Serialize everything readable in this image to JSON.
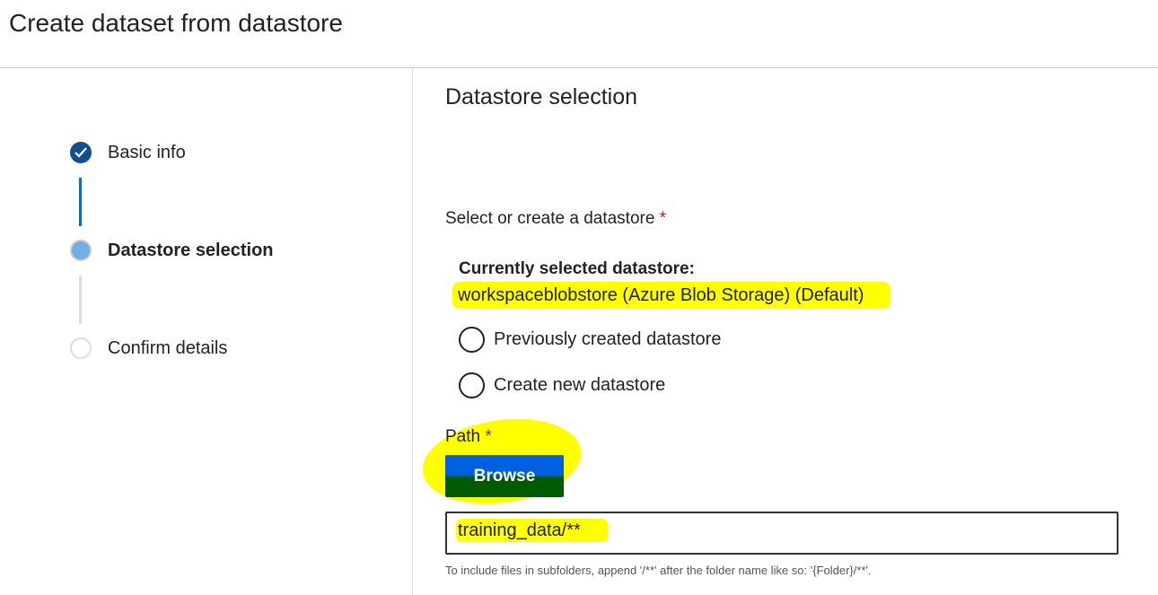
{
  "title": "Create dataset from datastore",
  "steps": [
    {
      "label": "Basic info",
      "state": "complete"
    },
    {
      "label": "Datastore selection",
      "state": "current"
    },
    {
      "label": "Confirm details",
      "state": "pending"
    }
  ],
  "section_title": "Datastore selection",
  "select_label": "Select or create a datastore",
  "required_mark": "*",
  "current_label": "Currently selected datastore:",
  "current_value": "workspaceblobstore (Azure Blob Storage) (Default)",
  "radios": [
    "Previously created datastore",
    "Create new datastore"
  ],
  "path_label": "Path",
  "browse_label": "Browse",
  "path_value": "training_data/**",
  "hint": "To include files in subfolders, append '/**' after the folder name like so: '{Folder}/**'.",
  "colors": {
    "accent": "#0f6cbd",
    "highlight": "#ffff00"
  }
}
